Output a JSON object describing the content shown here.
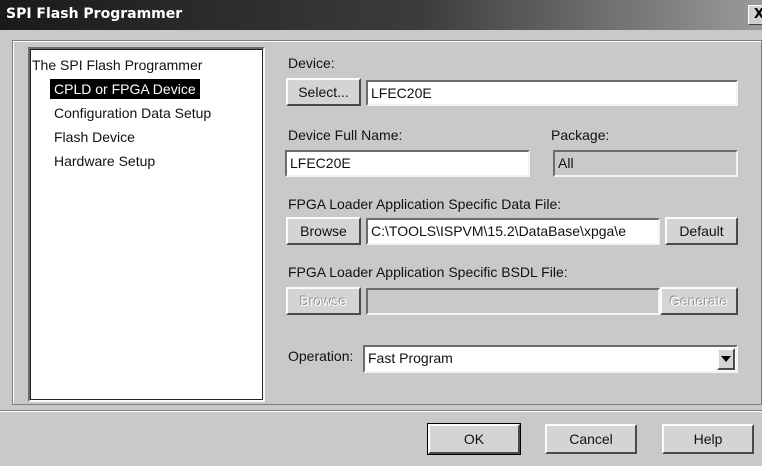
{
  "window": {
    "title": "SPI Flash Programmer",
    "close_label": "X"
  },
  "tree": {
    "root": "The SPI Flash Programmer",
    "items": [
      "CPLD or FPGA Device",
      "Configuration Data Setup",
      "Flash Device",
      "Hardware Setup"
    ],
    "selected_index": 0
  },
  "device": {
    "label": "Device:",
    "select_label": "Select...",
    "value": "LFEC20E"
  },
  "full_name": {
    "label": "Device Full Name:",
    "value": "LFEC20E"
  },
  "package": {
    "label": "Package:",
    "value": "All"
  },
  "data_file": {
    "label": "FPGA Loader Application Specific Data File:",
    "browse_label": "Browse",
    "value": "C:\\TOOLS\\ISPVM\\15.2\\DataBase\\xpga\\e",
    "default_label": "Default"
  },
  "bsdl_file": {
    "label": "FPGA Loader Application Specific BSDL File:",
    "browse_label": "Browse",
    "value": "",
    "generate_label": "Generate"
  },
  "operation": {
    "label": "Operation:",
    "value": "Fast Program"
  },
  "footer": {
    "ok_label": "OK",
    "cancel_label": "Cancel",
    "help_label": "Help"
  }
}
